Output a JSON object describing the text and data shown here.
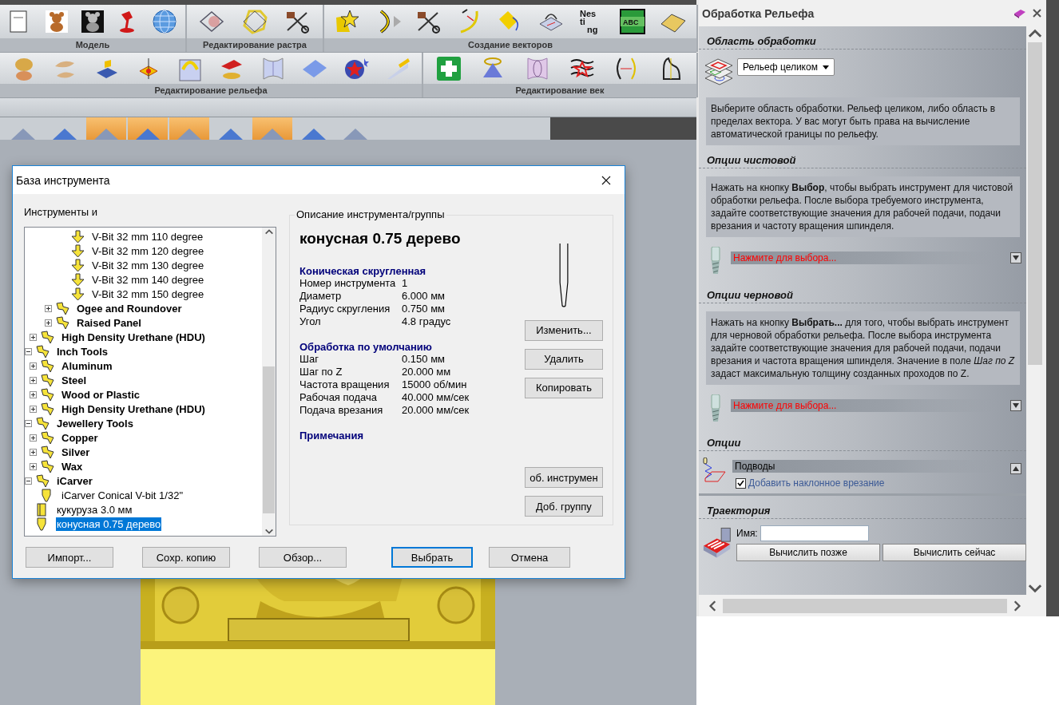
{
  "toolbars": [
    {
      "groups": [
        {
          "label": "Модель"
        },
        {
          "label": "Редактирование растра"
        },
        {
          "label": "Создание векторов",
          "nesting_icon": [
            "Nes",
            "ti",
            "ng"
          ],
          "abc_icon": "ABC"
        }
      ]
    },
    {
      "groups": [
        {
          "label": "Редактирование рельефа"
        },
        {
          "label": "Редактирование век"
        }
      ]
    }
  ],
  "dialog": {
    "title": "База инструмента",
    "tree_label": "Инструменты и",
    "tree": [
      {
        "children": [
          {
            "children": [
              {
                "children": [
                  {
                    "label": "V-Bit 32 mm 110 degree",
                    "kind": "vbit",
                    "selected": false
                  },
                  {
                    "label": "V-Bit 32 mm 120 degree",
                    "kind": "vbit",
                    "selected": false
                  },
                  {
                    "label": "V-Bit 32 mm 130 degree",
                    "kind": "vbit",
                    "selected": false
                  },
                  {
                    "label": "V-Bit 32 mm 140 degree",
                    "kind": "vbit",
                    "selected": false
                  },
                  {
                    "label": "V-Bit 32 mm 150 degree",
                    "kind": "vbit",
                    "selected": false
                  }
                ]
              },
              {
                "label": "Ogee and Roundover",
                "kind": "group",
                "expanded": false,
                "selected": false
              },
              {
                "label": "Raised Panel",
                "kind": "group",
                "expanded": false,
                "selected": false
              }
            ]
          },
          {
            "label": "High Density Urethane (HDU)",
            "kind": "group",
            "expanded": false,
            "selected": false
          }
        ]
      },
      {
        "label": "Inch Tools",
        "kind": "group",
        "expanded": true,
        "selected": false,
        "children": [
          {
            "label": "Aluminum",
            "kind": "group",
            "expanded": false,
            "selected": false
          },
          {
            "label": "Steel",
            "kind": "group",
            "expanded": false,
            "selected": false
          },
          {
            "label": "Wood or Plastic",
            "kind": "group",
            "expanded": false,
            "selected": false
          },
          {
            "label": "High Density Urethane (HDU)",
            "kind": "group",
            "expanded": false,
            "selected": false
          }
        ]
      },
      {
        "label": "Jewellery Tools",
        "kind": "group",
        "expanded": true,
        "selected": false,
        "children": [
          {
            "label": "Copper",
            "kind": "group",
            "expanded": false,
            "selected": false
          },
          {
            "label": "Silver",
            "kind": "group",
            "expanded": false,
            "selected": false
          },
          {
            "label": "Wax",
            "kind": "group",
            "expanded": false,
            "selected": false
          }
        ]
      },
      {
        "label": "iCarver",
        "kind": "group",
        "expanded": true,
        "selected": false,
        "children": [
          {
            "label": "iCarver Conical V-bit 1/32\"",
            "kind": "cone",
            "selected": false
          }
        ]
      },
      {
        "label": "кукуруза 3.0 мм",
        "kind": "cylinder",
        "selected": false
      },
      {
        "label": "конусная 0.75 дерево",
        "kind": "cone",
        "selected": true
      }
    ],
    "description": {
      "legend": "Описание инструмента/группы",
      "title": "конусная 0.75 дерево",
      "sections": [
        {
          "heading": "Коническая скругленная",
          "rows": [
            {
              "label": "Номер инструмента",
              "value": "1"
            },
            {
              "label": "Диаметр",
              "value": "6.000 мм"
            },
            {
              "label": "Радиус скругления",
              "value": "0.750 мм"
            },
            {
              "label": "Угол",
              "value": "4.8 градус"
            }
          ]
        },
        {
          "heading": "Обработка по умолчанию",
          "rows": [
            {
              "label": "Шаг",
              "value": "0.150 мм"
            },
            {
              "label": "Шаг по Z",
              "value": "20.000 мм"
            },
            {
              "label": "Частота вращения",
              "value": "15000 об/мин"
            },
            {
              "label": "Рабочая подача",
              "value": "40.000 мм/сек"
            },
            {
              "label": "Подача врезания",
              "value": "20.000 мм/сек"
            }
          ]
        },
        {
          "heading": "Примечания"
        }
      ]
    },
    "side_buttons": [
      "Изменить...",
      "Удалить",
      "Копировать"
    ],
    "lower_side_buttons": [
      "об. инструмен",
      "Доб. группу"
    ],
    "file_buttons": [
      "Импорт...",
      "Сохр. копию",
      "Обзор..."
    ],
    "action_buttons": [
      {
        "label": "Выбрать",
        "default": true
      },
      {
        "label": "Отмена",
        "default": false
      }
    ]
  },
  "panel": {
    "title": "Обработка Рельефа",
    "sections": [
      {
        "kind": "area",
        "heading": "Область обработки",
        "dropdown": "Рельеф целиком",
        "info": "Выберите область обработки. Рельеф целиком, либо область в пределах вектора. У вас могут быть права на вычисление автоматической границы по рельефу."
      },
      {
        "kind": "tool",
        "heading": "Опции чистовой",
        "info": "Нажать на кнопку **Выбор**, чтобы выбрать инструмент для чистовой обработки рельефа. После выбора требуемого инструмента, задайте соответствующие значения для рабочей подачи, подачи врезания и частоту вращения шпинделя.",
        "picker": "Нажмите для выбора..."
      },
      {
        "kind": "tool",
        "heading": "Опции черновой",
        "info": "Нажать на кнопку **Выбрать...** для того, чтобы выбрать инструмент для черновой обработки рельефа. После выбора инструмента задайте соответствующие значения для рабочей подачи, подачи врезания и частота вращения шпинделя. Значение в поле *Шаг по Z* задаст максимальную толщину созданных проходов по Z.",
        "picker": "Нажмите для выбора..."
      },
      {
        "kind": "options",
        "heading": "Опции",
        "group": "Подводы",
        "expanded": true,
        "checkbox": {
          "label": "Добавить наклонное врезание",
          "checked": true
        }
      },
      {
        "kind": "toolpath",
        "heading": "Траектория",
        "name_label": "Имя:",
        "buttons": [
          "Вычислить позже",
          "Вычислить сейчас"
        ]
      }
    ]
  }
}
